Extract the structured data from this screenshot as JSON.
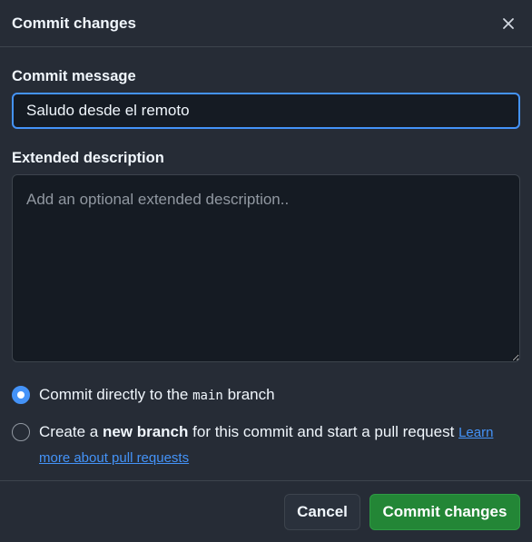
{
  "dialog": {
    "title": "Commit changes",
    "close_icon": "close-icon"
  },
  "commit_message": {
    "label": "Commit message",
    "value": "Saludo desde el remoto"
  },
  "extended_description": {
    "label": "Extended description",
    "placeholder": "Add an optional extended description..",
    "value": ""
  },
  "options": {
    "direct": {
      "selected": true,
      "text_before": "Commit directly to the",
      "branch": "main",
      "text_after": "branch"
    },
    "new_branch": {
      "selected": false,
      "text_before": "Create a",
      "emphasis": "new branch",
      "text_after": "for this commit and start a pull request",
      "link": "Learn more about pull requests"
    }
  },
  "footer": {
    "cancel_label": "Cancel",
    "commit_label": "Commit changes"
  },
  "colors": {
    "background": "#262c36",
    "accent": "#4493f8",
    "primary_button": "#238636"
  }
}
